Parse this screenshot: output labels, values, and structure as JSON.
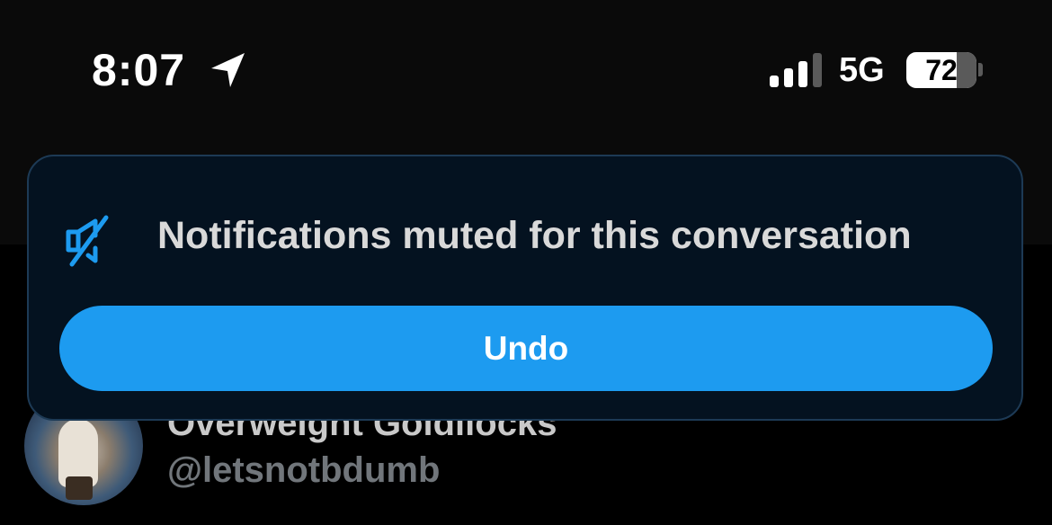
{
  "status_bar": {
    "time": "8:07",
    "location_icon": "location-arrow-icon",
    "signal_icon": "cellular-signal-icon",
    "network": "5G",
    "battery_level": "72",
    "battery_fraction": 0.72
  },
  "toast": {
    "icon": "muted-speaker-icon",
    "message": "Notifications muted for this conversation",
    "undo_label": "Undo",
    "accent_color": "#1d9bf0",
    "background_color": "#041220"
  },
  "profile": {
    "name": "Overweight Goldilocks",
    "handle": "@letsnotbdumb"
  }
}
